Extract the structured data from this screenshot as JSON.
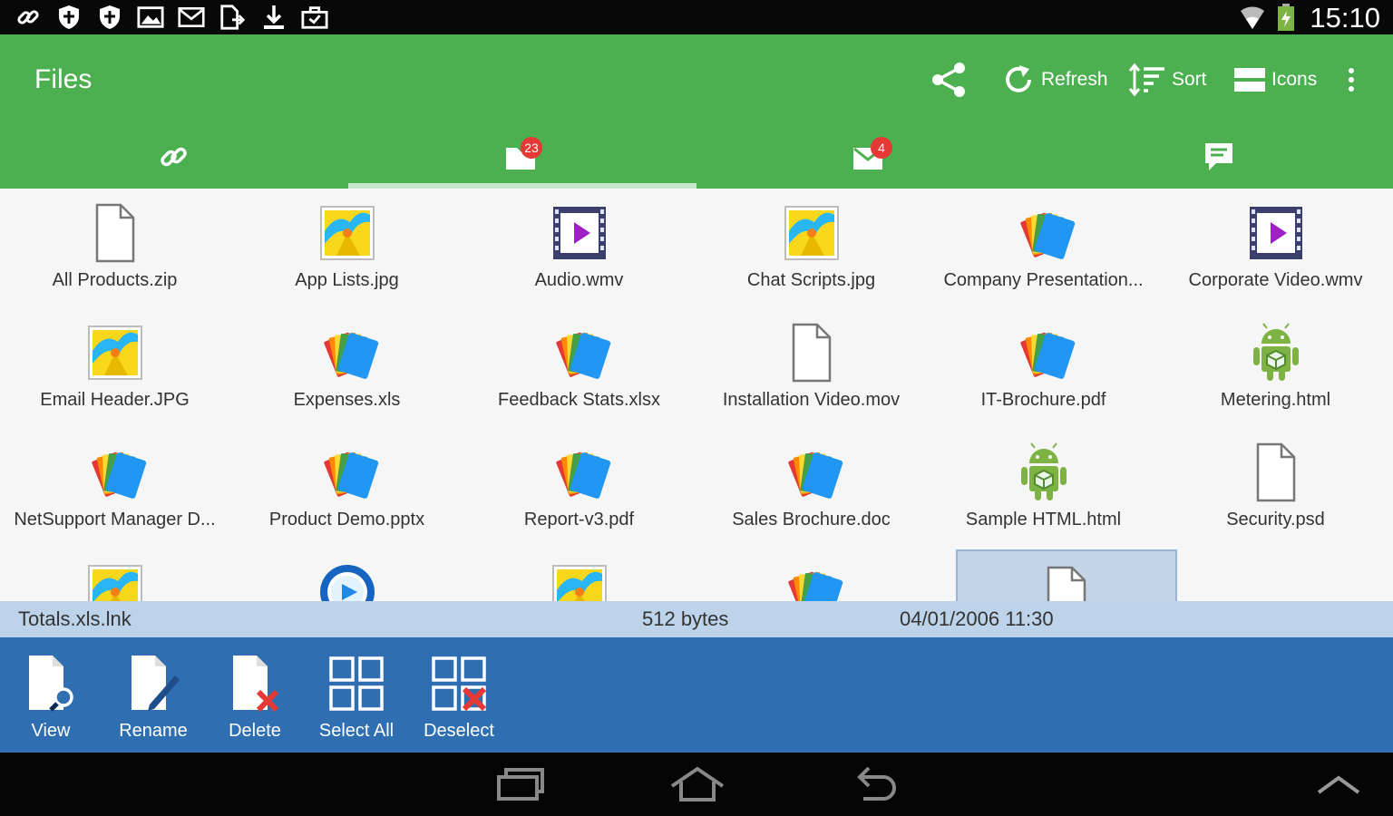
{
  "status_bar": {
    "time": "15:10",
    "left_icons": [
      "link-icon",
      "shield-icon",
      "shield-icon",
      "image-icon",
      "mail-icon",
      "file-export-icon",
      "download-icon",
      "briefcase-icon"
    ],
    "right_icons": [
      "wifi-icon",
      "battery-charging-icon"
    ]
  },
  "app_bar": {
    "title": "Files",
    "actions": [
      {
        "icon": "share-icon",
        "label": ""
      },
      {
        "icon": "refresh-icon",
        "label": "Refresh"
      },
      {
        "icon": "sort-icon",
        "label": "Sort"
      },
      {
        "icon": "icons-view-icon",
        "label": "Icons"
      },
      {
        "icon": "overflow-menu-icon",
        "label": ""
      }
    ]
  },
  "tabs": [
    {
      "icon": "link-icon",
      "badge": ""
    },
    {
      "icon": "folder-icon",
      "badge": "23"
    },
    {
      "icon": "mail-icon",
      "badge": "4"
    },
    {
      "icon": "chat-icon",
      "badge": ""
    }
  ],
  "active_tab": 1,
  "files": [
    {
      "name": "All Products.zip",
      "icon": "blank"
    },
    {
      "name": "App Lists.jpg",
      "icon": "image"
    },
    {
      "name": "Audio.wmv",
      "icon": "video"
    },
    {
      "name": "Chat Scripts.jpg",
      "icon": "image"
    },
    {
      "name": "Company Presentation...",
      "icon": "doc"
    },
    {
      "name": "Corporate Video.wmv",
      "icon": "video"
    },
    {
      "name": "Email Header.JPG",
      "icon": "image"
    },
    {
      "name": "Expenses.xls",
      "icon": "doc"
    },
    {
      "name": "Feedback Stats.xlsx",
      "icon": "doc"
    },
    {
      "name": "Installation Video.mov",
      "icon": "blank"
    },
    {
      "name": "IT-Brochure.pdf",
      "icon": "doc"
    },
    {
      "name": "Metering.html",
      "icon": "android"
    },
    {
      "name": "NetSupport Manager D...",
      "icon": "doc"
    },
    {
      "name": "Product Demo.pptx",
      "icon": "doc"
    },
    {
      "name": "Report-v3.pdf",
      "icon": "doc"
    },
    {
      "name": "Sales Brochure.doc",
      "icon": "doc"
    },
    {
      "name": "Sample HTML.html",
      "icon": "android"
    },
    {
      "name": "Security.psd",
      "icon": "blank"
    },
    {
      "name": "",
      "icon": "image"
    },
    {
      "name": "",
      "icon": "media"
    },
    {
      "name": "",
      "icon": "image"
    },
    {
      "name": "",
      "icon": "doc"
    },
    {
      "name": "",
      "icon": "blank",
      "selected": true
    }
  ],
  "selection_info": {
    "name": "Totals.xls.lnk",
    "size": "512 bytes",
    "date": "04/01/2006 11:30"
  },
  "bottom_actions": [
    {
      "icon": "view-file-icon",
      "label": "View"
    },
    {
      "icon": "rename-file-icon",
      "label": "Rename"
    },
    {
      "icon": "delete-file-icon",
      "label": "Delete"
    },
    {
      "icon": "select-all-icon",
      "label": "Select All"
    },
    {
      "icon": "deselect-icon",
      "label": "Deselect"
    }
  ],
  "nav_bar": [
    "recent-apps-icon",
    "home-icon",
    "back-icon",
    "expand-up-icon"
  ],
  "colors": {
    "status_bar": "#080808",
    "app_bar": "#4caf50",
    "info_bar": "#bcd3ea",
    "bottom_bar": "#2f6eb0",
    "nav_bar": "#050505",
    "badge": "#e53935"
  }
}
